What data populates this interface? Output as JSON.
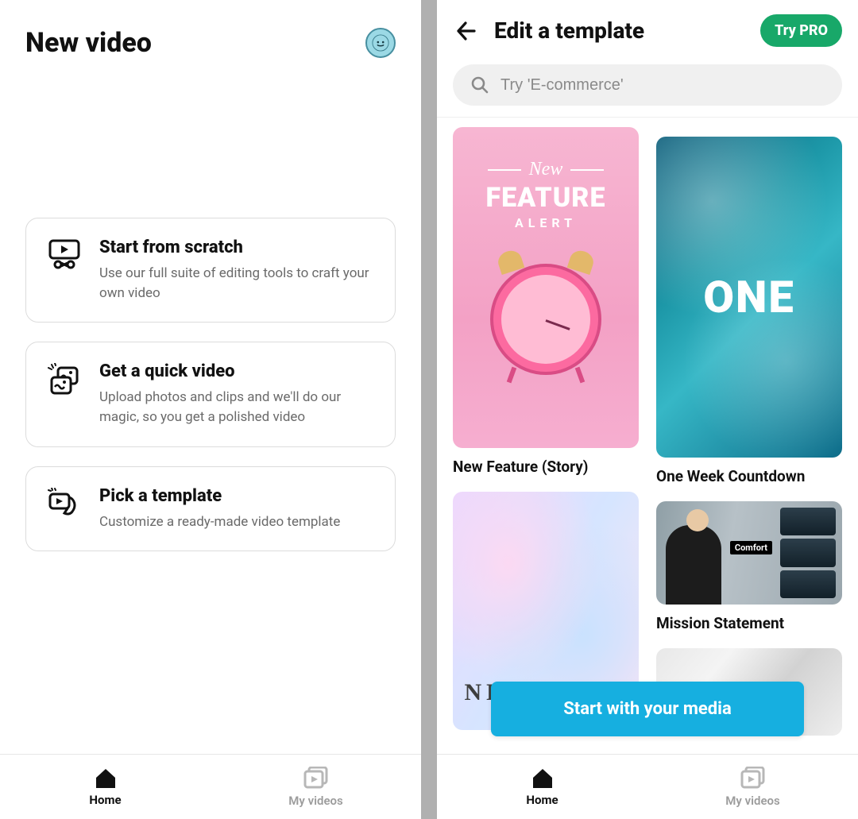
{
  "left": {
    "title": "New video",
    "cards": [
      {
        "title": "Start from scratch",
        "desc": "Use our full suite of editing tools to craft your own video"
      },
      {
        "title": "Get a quick video",
        "desc": "Upload photos and clips and we'll do our magic, so you get a polished video"
      },
      {
        "title": "Pick a template",
        "desc": "Customize a ready-made video template"
      }
    ],
    "nav": {
      "home": "Home",
      "videos": "My videos"
    }
  },
  "right": {
    "title": "Edit a template",
    "pro_label": "Try PRO",
    "search_placeholder": "Try 'E-commerce'",
    "templates": {
      "t1": {
        "label": "New Feature (Story)",
        "line1": "New",
        "line2": "FEATURE",
        "line3": "ALERT"
      },
      "t2": {
        "label": "One Week Countdown",
        "big_text": "ONE"
      },
      "t3": {
        "overlay_text": "NEW POST"
      },
      "t4": {
        "label": "Mission Statement",
        "tag": "Comfort"
      }
    },
    "start_media": "Start with your media",
    "nav": {
      "home": "Home",
      "videos": "My videos"
    }
  }
}
